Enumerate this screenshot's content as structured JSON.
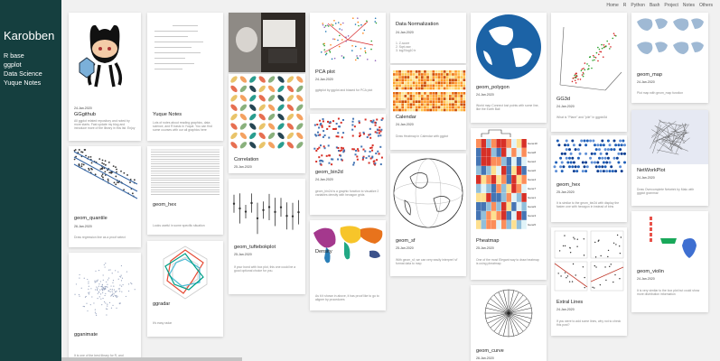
{
  "sidebar": {
    "title": "Karobben",
    "menu": [
      "R base",
      "ggplot",
      "Data Science",
      "Yuque Notes"
    ]
  },
  "topnav": [
    "Home",
    "R",
    "Python",
    "Bash",
    "Project",
    "Notes",
    "Others"
  ],
  "cards": {
    "ggithub": {
      "title": "GGgithub",
      "date": "24.Jan.2020",
      "desc": "All ggplot related repository and noted by more starts. Fast update my blog and introduce more of the library in this list. Enjoy"
    },
    "quantile": {
      "title": "geom_quantile",
      "date": "26.Jan.2020",
      "desc": "Draw regression line as a proof select"
    },
    "ggplot_anim": {
      "title": "gganimate",
      "date": "",
      "desc": "It is one of the best library for R, and"
    },
    "yuque": {
      "title": "Yuque Notes",
      "date": "",
      "desc": "Lots of notes about reading graphics, data science, and R basis in Yuque. You can find some courses with our all graphics here"
    },
    "hex": {
      "title": "geom_hex",
      "date": "",
      "desc": "Looks useful in some specific situation"
    },
    "radar": {
      "title": "ggradar",
      "date": "",
      "desc": "It's easy radar"
    },
    "correlation": {
      "title": "Correlation",
      "date": "25.Jan.2020",
      "desc": ""
    },
    "tufte": {
      "title": "geom_tuftebokplot",
      "date": "25.Jan.2020",
      "desc": "If your bond with box plot, this one could be a good optional choice for you."
    },
    "pca": {
      "title": "PCA plot",
      "date": "24.Jan.2020",
      "desc": "ggbiplot by ggplot and biased for PCA plot"
    },
    "bin2d": {
      "title": "geom_bin2d",
      "date": "24.Jan.2020",
      "desc": "geom_bin2d is a graphic function to visualize 2 variables density with hexagon grids"
    },
    "density": {
      "title": "Density",
      "date": "25.Jan.2020",
      "desc": "As it it shown in above, it has proof like to go to aligner by procedures"
    },
    "datanorm": {
      "title": "Data Normalization",
      "date": "24.Jan.2020",
      "desc": "1. Z-score\n2. Sqrt-raw\n3. log2/log10 tr"
    },
    "calendar": {
      "title": "Calendar",
      "date": "24.Jan.2020",
      "desc": "Draw Heatmap in Calendar with ggplot"
    },
    "geomsf": {
      "title": "geom_sf",
      "date": "25.Jan.2020",
      "desc": "With geom_sf, we can very easily interpret 'sf' format data to map"
    },
    "polygon": {
      "title": "geom_polygon",
      "date": "24.Jan.2020",
      "desc": "World map Connect lost points with some line, like the Earth Ball"
    },
    "pheatmap": {
      "title": "Pheatmap",
      "date": "25.Jan.2020",
      "desc": "One of the most Elegant way to draw heatmap is using pheatmap"
    },
    "curve": {
      "title": "geom_curve",
      "date": "26.Jan.2020",
      "desc": ""
    },
    "gg3d": {
      "title": "GG3d",
      "date": "24.Jan.2020",
      "desc": "What is \"Plane\" and \"pile\" in ggplot3d"
    },
    "geomhex2": {
      "title": "geom_hex",
      "date": "25.Jan.2020",
      "desc": "It is similar to the geom_bin2d with display the fasten one with hexagon in instead of bins"
    },
    "extralines": {
      "title": "Extral Lines",
      "date": "24.Jan.2020",
      "desc": "If you were to add some lines, why not to check this post?"
    },
    "geommap": {
      "title": "geom_map",
      "date": "24.Jan.2020",
      "desc": "Plot map with geom_map function"
    },
    "network": {
      "title": "NetWorkPlot",
      "date": "24.Jan.2020",
      "desc": "Draw Overcomplete Netwbrk by Malu with ggplot grammar"
    },
    "violin": {
      "title": "geom_violin",
      "date": "24.Jan.2020",
      "desc": "It is very similar to the box plot but could show more distribution information"
    }
  },
  "pheatmap_labels": [
    "Gene10",
    "Gene8",
    "Gene2",
    "Gene6",
    "Gene4",
    "Gene7",
    "Gene1",
    "Gene9",
    "Gene3",
    "Gene5"
  ],
  "colors": {
    "sidebar_bg": "#153f3f",
    "accent_orange": "#e68a2e"
  }
}
